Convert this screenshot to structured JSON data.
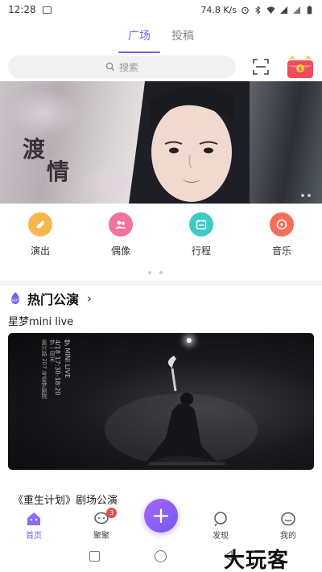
{
  "status_bar": {
    "time": "12:28",
    "network_speed": "74.8 K/s",
    "icons": [
      "image-icon",
      "alarm-icon",
      "bluetooth-icon",
      "wifi-icon",
      "signal-icon",
      "signal-icon",
      "battery-icon"
    ]
  },
  "top_tabs": [
    {
      "label": "广场",
      "active": true
    },
    {
      "label": "投稿",
      "active": false
    }
  ],
  "search": {
    "placeholder": "搜索"
  },
  "banner": {
    "title_line1": "渡",
    "title_line2": "情"
  },
  "quick_nav": [
    {
      "label": "演出",
      "icon": "ticket-icon",
      "color": "#f6a623"
    },
    {
      "label": "偶像",
      "icon": "people-icon",
      "color": "#f05a8e"
    },
    {
      "label": "行程",
      "icon": "calendar-icon",
      "color": "#2dc6c0"
    },
    {
      "label": "音乐",
      "icon": "music-disc-icon",
      "color": "#f25a45"
    }
  ],
  "hot_section": {
    "badge_text": "HOT",
    "title": "热门公演",
    "show1_title": "星梦mini live",
    "show1_poster": {
      "line1": "梦 MINI LIVE",
      "line2": "4/18 17:30-18:20",
      "line3": "梦 | 周末",
      "line4": "嘉兴路 207 号星梦剧院"
    },
    "show2_title": "《重生计划》剧场公演"
  },
  "bottom_nav": [
    {
      "label": "首页",
      "icon": "home-icon",
      "active": true
    },
    {
      "label": "聚聚",
      "icon": "chat-bubble-icon",
      "badge": "3"
    },
    {
      "label": "发现",
      "icon": "discover-icon"
    },
    {
      "label": "我的",
      "icon": "profile-icon"
    }
  ],
  "fab": {
    "label": "+"
  },
  "watermark": "大玩客",
  "colors": {
    "accent": "#7b5cf5",
    "badge": "#ef4b4b"
  }
}
